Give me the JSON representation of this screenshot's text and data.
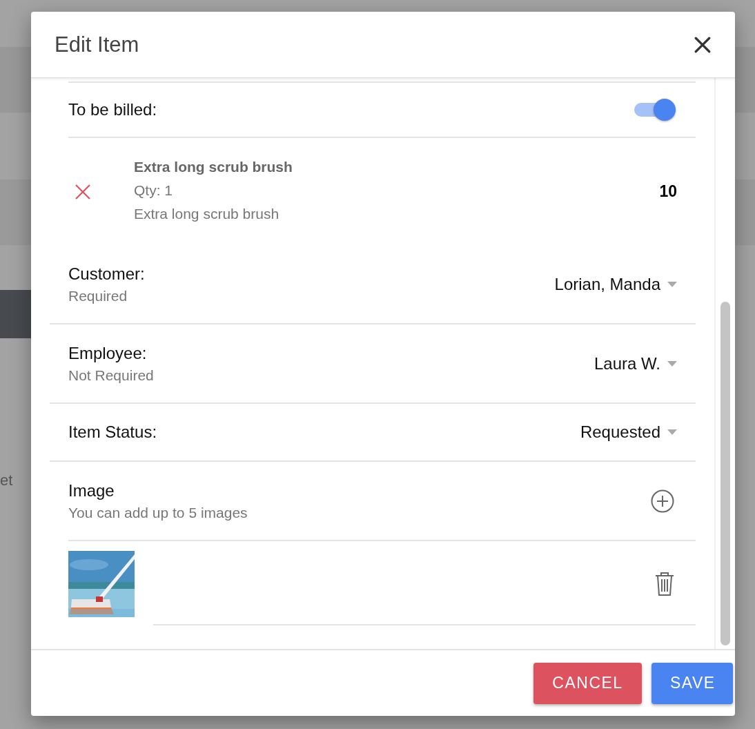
{
  "backdrop": {
    "text": "et"
  },
  "dialog": {
    "title": "Edit Item",
    "billing": {
      "label": "To be billed:",
      "on": true
    },
    "line_item": {
      "name": "Extra long scrub brush",
      "qty": "Qty: 1",
      "description": "Extra long scrub brush",
      "amount": "10"
    },
    "fields": [
      {
        "label": "Customer:",
        "hint": "Required",
        "value": "Lorian, Manda"
      },
      {
        "label": "Employee:",
        "hint": "Not Required",
        "value": "Laura W."
      },
      {
        "label": "Item Status:",
        "value": "Requested"
      }
    ],
    "image_section": {
      "label": "Image",
      "hint": "You can add up to 5 images"
    },
    "buttons": [
      {
        "label": "CANCEL",
        "kind": "cancel"
      },
      {
        "label": "SAVE",
        "kind": "save"
      }
    ]
  }
}
